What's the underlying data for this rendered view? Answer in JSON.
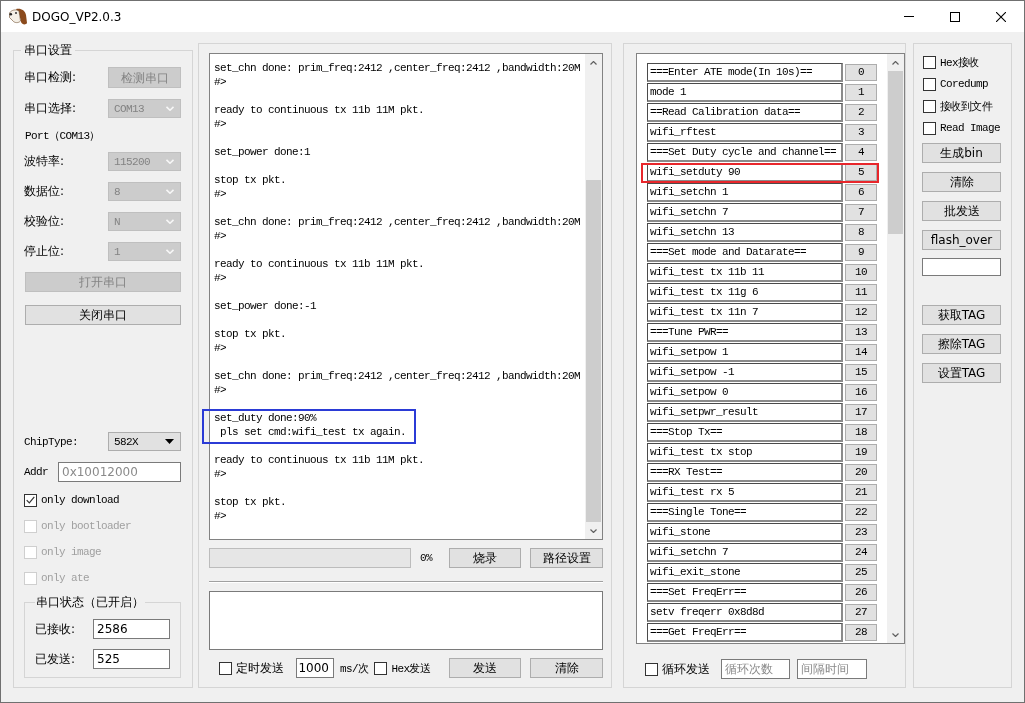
{
  "window": {
    "title": "DOGO_VP2.0.3"
  },
  "serial_settings": {
    "title": "串口设置",
    "rows": [
      {
        "kind": "button",
        "label": "串口检测:",
        "button": "检测串口",
        "disabled": true
      },
      {
        "kind": "combo",
        "label": "串口选择:",
        "value": "COM13",
        "disabled": true
      },
      {
        "kind": "note",
        "text": "Port（COM13）"
      },
      {
        "kind": "combo",
        "label": "波特率:",
        "value": "115200",
        "disabled": true
      },
      {
        "kind": "combo",
        "label": "数据位:",
        "value": "8",
        "disabled": true
      },
      {
        "kind": "combo",
        "label": "校验位:",
        "value": "N",
        "disabled": true
      },
      {
        "kind": "combo",
        "label": "停止位:",
        "value": "1",
        "disabled": true
      }
    ],
    "buttons": [
      {
        "label": "打开串口",
        "disabled": true
      },
      {
        "label": "关闭串口",
        "disabled": false
      }
    ],
    "chip_type": {
      "label": "ChipType:",
      "value": "582X",
      "disabled": false
    },
    "addr": {
      "label": "Addr",
      "placeholder": "0x10012000"
    },
    "options": [
      {
        "label": "only download",
        "checked": true,
        "disabled": false
      },
      {
        "label": "only bootloader",
        "checked": false,
        "disabled": true
      },
      {
        "label": "only image",
        "checked": false,
        "disabled": true
      },
      {
        "label": "only ate",
        "checked": false,
        "disabled": true
      }
    ],
    "status": {
      "title": "串口状态（已开启）",
      "fields": [
        {
          "label": "已接收:",
          "value": "2586"
        },
        {
          "label": "已发送:",
          "value": "525"
        }
      ]
    }
  },
  "log": {
    "blocks": [
      {
        "lines": [
          "set_chn done: prim_freq:2412 ,center_freq:2412 ,bandwidth:20M",
          "#>"
        ],
        "annotated": false
      },
      {
        "lines": [
          "ready to continuous tx 11b 11M pkt.",
          "#>"
        ],
        "annotated": false
      },
      {
        "lines": [
          "set_power done:1"
        ],
        "annotated": false
      },
      {
        "lines": [
          "stop tx pkt.",
          "#>"
        ],
        "annotated": false
      },
      {
        "lines": [
          "set_chn done: prim_freq:2412 ,center_freq:2412 ,bandwidth:20M",
          "#>"
        ],
        "annotated": false
      },
      {
        "lines": [
          "ready to continuous tx 11b 11M pkt.",
          "#>"
        ],
        "annotated": false
      },
      {
        "lines": [
          "set_power done:-1"
        ],
        "annotated": false
      },
      {
        "lines": [
          "stop tx pkt.",
          "#>"
        ],
        "annotated": false
      },
      {
        "lines": [
          "set_chn done: prim_freq:2412 ,center_freq:2412 ,bandwidth:20M",
          "#>"
        ],
        "annotated": false
      },
      {
        "lines": [
          "set_duty done:90%",
          " pls set cmd:wifi_test tx again."
        ],
        "annotated": true
      },
      {
        "lines": [
          "ready to continuous tx 11b 11M pkt.",
          "#>"
        ],
        "annotated": false
      },
      {
        "lines": [
          "stop tx pkt.",
          "#>"
        ],
        "annotated": false
      }
    ]
  },
  "flash": {
    "progress": {
      "level": 0,
      "text": "0%"
    },
    "buttons": [
      "烧录",
      "路径设置"
    ]
  },
  "send": {
    "timed": {
      "label": "定时发送",
      "checked": false
    },
    "interval": {
      "value": "1000",
      "unit": "ms/次"
    },
    "hex": {
      "label": "Hex发送",
      "checked": false
    },
    "buttons": [
      "发送",
      "清除"
    ]
  },
  "commands": {
    "rows": [
      {
        "text": "===Enter ATE mode(In 10s)==",
        "number": "0",
        "annotated": false
      },
      {
        "text": "mode 1",
        "number": "1",
        "annotated": false
      },
      {
        "text": "==Read Calibration data==",
        "number": "2",
        "annotated": false
      },
      {
        "text": "wifi_rftest",
        "number": "3",
        "annotated": false
      },
      {
        "text": "===Set Duty cycle and channel==",
        "number": "4",
        "annotated": false
      },
      {
        "text": "wifi_setduty 90",
        "number": "5",
        "annotated": true
      },
      {
        "text": "wifi_setchn 1",
        "number": "6",
        "annotated": false
      },
      {
        "text": "wifi_setchn 7",
        "number": "7",
        "annotated": false
      },
      {
        "text": "wifi_setchn 13",
        "number": "8",
        "annotated": false
      },
      {
        "text": "===Set mode and Datarate==",
        "number": "9",
        "annotated": false
      },
      {
        "text": "wifi_test tx 11b 11",
        "number": "10",
        "annotated": false
      },
      {
        "text": "wifi_test tx 11g 6",
        "number": "11",
        "annotated": false
      },
      {
        "text": "wifi_test tx 11n 7",
        "number": "12",
        "annotated": false
      },
      {
        "text": "===Tune PWR==",
        "number": "13",
        "annotated": false
      },
      {
        "text": "wifi_setpow 1",
        "number": "14",
        "annotated": false
      },
      {
        "text": "wifi_setpow -1",
        "number": "15",
        "annotated": false
      },
      {
        "text": "wifi_setpow 0",
        "number": "16",
        "annotated": false
      },
      {
        "text": "wifi_setpwr_result",
        "number": "17",
        "annotated": false
      },
      {
        "text": "===Stop Tx==",
        "number": "18",
        "annotated": false
      },
      {
        "text": "wifi_test tx stop",
        "number": "19",
        "annotated": false
      },
      {
        "text": "===RX Test==",
        "number": "20",
        "annotated": false
      },
      {
        "text": "wifi_test rx 5",
        "number": "21",
        "annotated": false
      },
      {
        "text": "===Single Tone==",
        "number": "22",
        "annotated": false
      },
      {
        "text": "wifi_stone",
        "number": "23",
        "annotated": false
      },
      {
        "text": "wifi_setchn 7",
        "number": "24",
        "annotated": false
      },
      {
        "text": "wifi_exit_stone",
        "number": "25",
        "annotated": false
      },
      {
        "text": "===Set FreqErr==",
        "number": "26",
        "annotated": false
      },
      {
        "text": "setv freqerr 0x8d8d",
        "number": "27",
        "annotated": false
      },
      {
        "text": "===Get FreqErr==",
        "number": "28",
        "annotated": false
      }
    ],
    "loop": {
      "label": "循环发送",
      "checked": false,
      "count_placeholder": "循环次数",
      "interval_placeholder": "间隔时间"
    }
  },
  "tools": {
    "options": [
      {
        "label": "Hex接收",
        "checked": false
      },
      {
        "label": "Coredump",
        "checked": false
      },
      {
        "label": "接收到文件",
        "checked": false
      },
      {
        "label": "Read Image",
        "checked": false
      }
    ],
    "buttons": [
      "生成bin",
      "清除",
      "批发送",
      "flash_over"
    ],
    "tag_buttons": [
      "获取TAG",
      "擦除TAG",
      "设置TAG"
    ]
  }
}
